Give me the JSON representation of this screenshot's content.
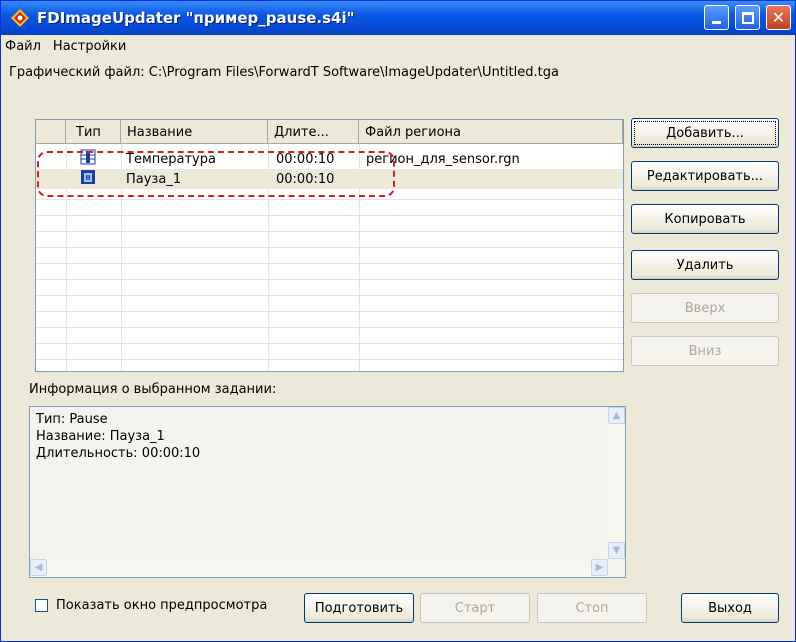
{
  "window": {
    "title": "FDImageUpdater \"пример_pause.s4i\""
  },
  "menu": {
    "items": [
      "Файл",
      "Настройки"
    ]
  },
  "file_path": "Графический файл: C:\\Program Files\\ForwardT Software\\ImageUpdater\\Untitled.tga",
  "table": {
    "columns": [
      "Тип",
      "Название",
      "Длите...",
      "Файл региона"
    ],
    "rows": [
      {
        "icon": "sensor-icon",
        "name": "Температура",
        "duration": "00:00:10",
        "region": "регион_для_sensor.rgn"
      },
      {
        "icon": "pause-icon",
        "name": "Пауза_1",
        "duration": "00:00:10",
        "region": ""
      }
    ]
  },
  "buttons": {
    "add": "Добавить...",
    "edit": "Редактировать...",
    "copy": "Копировать",
    "delete": "Удалить",
    "up": "Вверх",
    "down": "Вниз"
  },
  "info": {
    "label": "Информация о выбранном задании:",
    "lines": [
      "Тип: Pause",
      "Название: Пауза_1",
      "Длительность: 00:00:10"
    ]
  },
  "bottom": {
    "preview_checkbox": "Показать окно предпросмотра",
    "prepare": "Подготовить",
    "start": "Старт",
    "stop": "Стоп",
    "exit": "Выход"
  },
  "colors": {
    "titlebar": "#0a58e6",
    "selection": "#ece9d8",
    "highlight_dashes": "#d0202a"
  }
}
